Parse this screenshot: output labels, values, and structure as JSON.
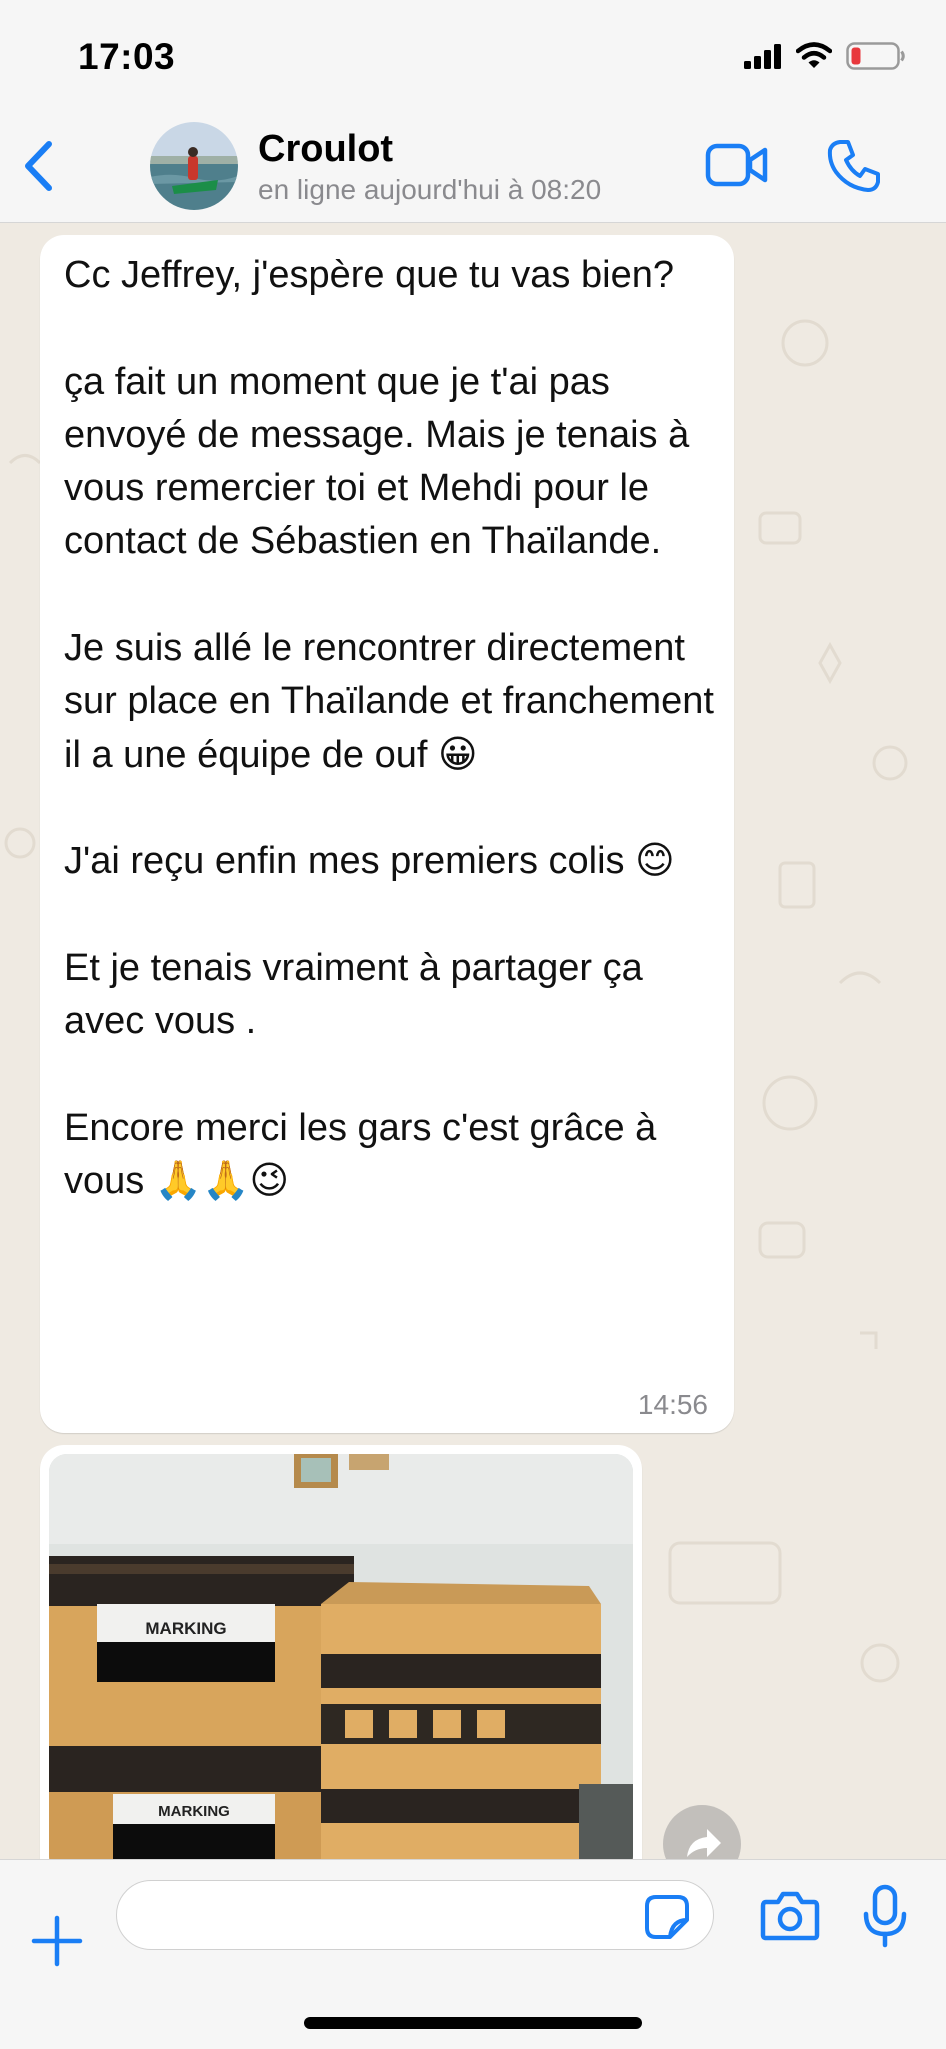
{
  "status_bar": {
    "time": "17:03",
    "icons": [
      "signal-icon",
      "wifi-icon",
      "battery-low-icon"
    ]
  },
  "header": {
    "back_icon": "chevron-left-icon",
    "contact_name": "Croulot",
    "contact_status": "en ligne aujourd'hui à 08:20",
    "actions": [
      "video-call-icon",
      "phone-icon"
    ]
  },
  "messages": [
    {
      "type": "text",
      "text": "Cc Jeffrey, j'espère que tu vas bien?\n\nça fait un moment que je t'ai pas envoyé de message. Mais je tenais à vous remercier toi et Mehdi pour le contact de Sébastien en Thaïlande.\n\nJe suis allé le rencontrer directement sur place en Thaïlande et franchement il a une équipe de ouf 😀\n\nJ'ai reçu enfin mes premiers colis 😊\n\nEt je tenais vraiment à partager ça avec vous .\n\nEncore merci les gars c'est grâce à vous 🙏🙏😉",
      "time": "14:56"
    },
    {
      "type": "image",
      "box_label_1": "MARKING",
      "box_label_2": "MARKING"
    }
  ],
  "input_bar": {
    "placeholder": "",
    "icons": [
      "plus-icon",
      "sticker-icon",
      "camera-icon",
      "microphone-icon"
    ]
  },
  "colors": {
    "accent": "#1a7ef5",
    "chat_background": "#efeae2",
    "bubble": "#ffffff",
    "battery_low": "#e8383d"
  }
}
